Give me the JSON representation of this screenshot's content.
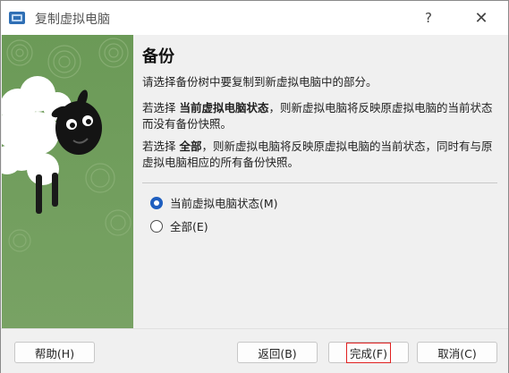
{
  "window": {
    "title": "复制虚拟电脑",
    "help_glyph": "?",
    "close_glyph": "✕"
  },
  "page": {
    "heading": "备份",
    "p1": "请选择备份树中要复制到新虚拟电脑中的部分。",
    "p2_prefix": "若选择 ",
    "p2_bold": "当前虚拟电脑状态",
    "p2_suffix": "，则新虚拟电脑将反映原虚拟电脑的当前状态而没有备份快照。",
    "p3_prefix": "若选择 ",
    "p3_bold": "全部",
    "p3_suffix": "，则新虚拟电脑将反映原虚拟电脑的当前状态，同时有与原虚拟电脑相应的所有备份快照。"
  },
  "options": [
    {
      "label": "当前虚拟电脑状态(M)",
      "checked": true
    },
    {
      "label": "全部(E)",
      "checked": false
    }
  ],
  "buttons": {
    "help": "帮助(H)",
    "back": "返回(B)",
    "finish": "完成(F)",
    "cancel": "取消(C)"
  },
  "colors": {
    "accent": "#1f5fbf",
    "focus_outline": "#e02020",
    "sheep_bg": "#6f9a5a"
  }
}
